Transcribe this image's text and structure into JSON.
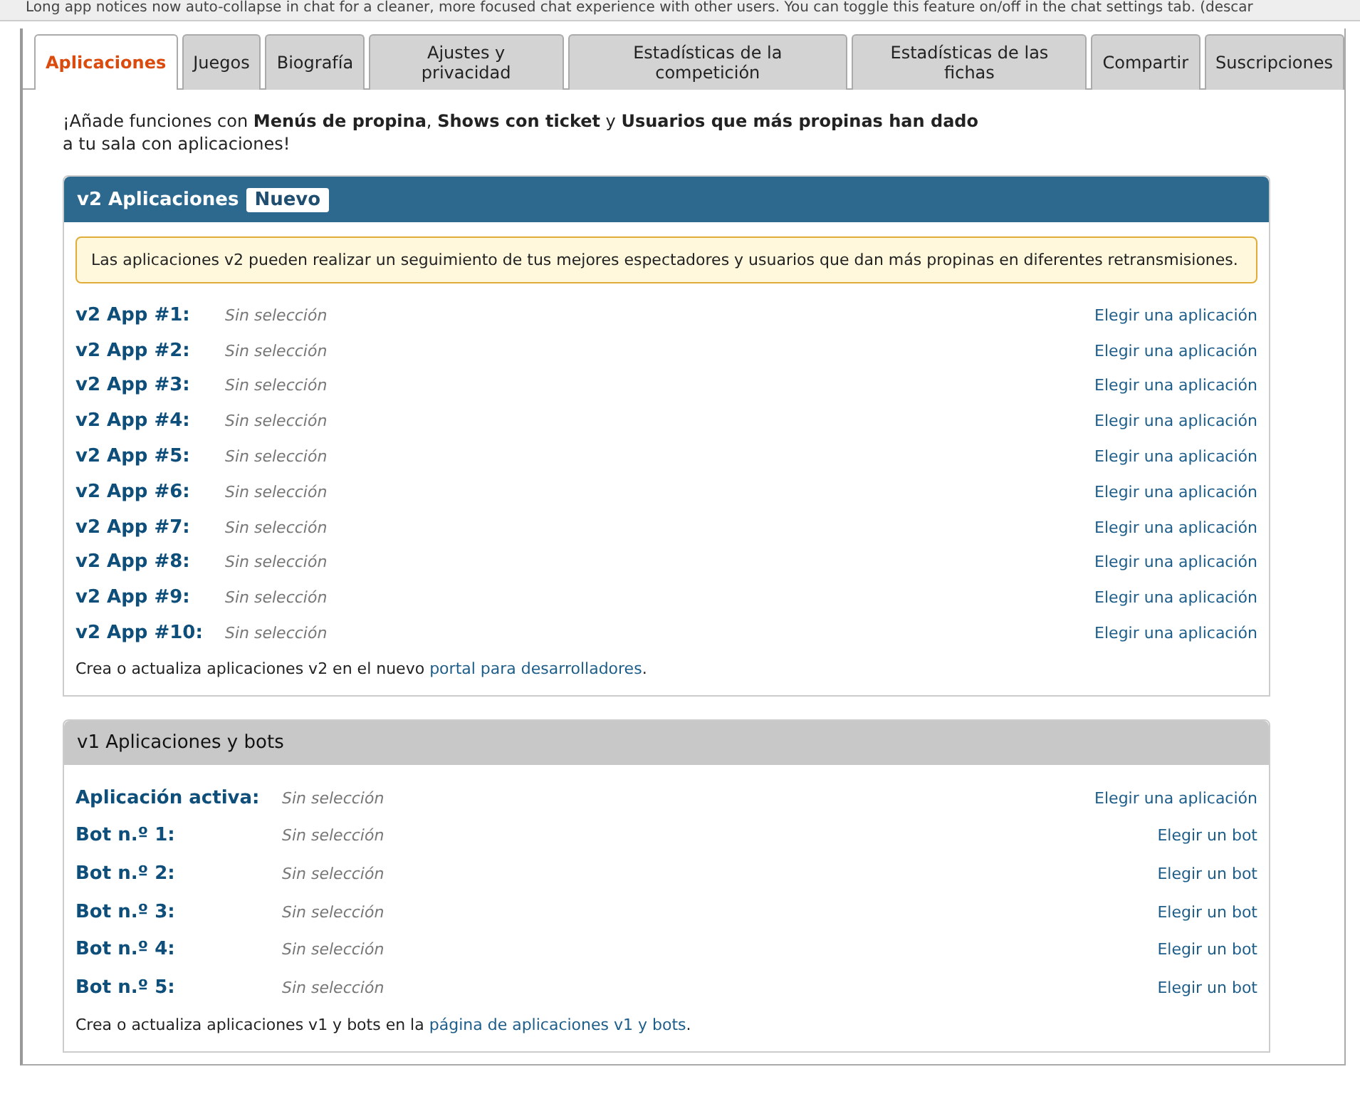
{
  "notice": "Long app notices now auto-collapse in chat for a cleaner, more focused chat experience with other users. You can toggle this feature on/off in the chat settings tab. (descar",
  "tabs": [
    {
      "label": "Aplicaciones",
      "selected": true
    },
    {
      "label": "Juegos",
      "selected": false
    },
    {
      "label": "Biografía",
      "selected": false
    },
    {
      "label": "Ajustes y privacidad",
      "selected": false
    },
    {
      "label": "Estadísticas de la competición",
      "selected": false
    },
    {
      "label": "Estadísticas de las fichas",
      "selected": false
    },
    {
      "label": "Compartir",
      "selected": false
    },
    {
      "label": "Suscripciones",
      "selected": false
    }
  ],
  "intro": [
    "¡Añade funciones con **Menús de propina**, **Shows con ticket** y **Usuarios que más propinas han dado**",
    "a tu sala con aplicaciones!"
  ],
  "panels": [
    {
      "kind": "featured",
      "title": "v2 Aplicaciones",
      "badge": "Nuevo",
      "info": "Las aplicaciones v2 pueden realizar un seguimiento de tus mejores espectadores y usuarios que dan más propinas en diferentes retransmisiones.",
      "rows": [
        {
          "label": "v2 App #1:",
          "value": "Sin selección",
          "action": "Elegir una aplicación"
        },
        {
          "label": "v2 App #2:",
          "value": "Sin selección",
          "action": "Elegir una aplicación"
        },
        {
          "label": "v2 App #3:",
          "value": "Sin selección",
          "action": "Elegir una aplicación"
        },
        {
          "label": "v2 App #4:",
          "value": "Sin selección",
          "action": "Elegir una aplicación"
        },
        {
          "label": "v2 App #5:",
          "value": "Sin selección",
          "action": "Elegir una aplicación"
        },
        {
          "label": "v2 App #6:",
          "value": "Sin selección",
          "action": "Elegir una aplicación"
        },
        {
          "label": "v2 App #7:",
          "value": "Sin selección",
          "action": "Elegir una aplicación"
        },
        {
          "label": "v2 App #8:",
          "value": "Sin selección",
          "action": "Elegir una aplicación"
        },
        {
          "label": "v2 App #9:",
          "value": "Sin selección",
          "action": "Elegir una aplicación"
        },
        {
          "label": "v2 App #10:",
          "value": "Sin selección",
          "action": "Elegir una aplicación"
        }
      ],
      "footer": {
        "before": "Crea o actualiza aplicaciones v2 en el nuevo",
        "link": "portal para desarrolladores",
        "after": "."
      }
    },
    {
      "kind": "legacy",
      "title": "v1 Aplicaciones y bots",
      "rows": [
        {
          "label": "Aplicación activa:",
          "value": "Sin selección",
          "action": "Elegir una aplicación"
        },
        {
          "label": "Bot n.º 1:",
          "value": "Sin selección",
          "action": "Elegir un bot"
        },
        {
          "label": "Bot n.º 2:",
          "value": "Sin selección",
          "action": "Elegir un bot"
        },
        {
          "label": "Bot n.º 3:",
          "value": "Sin selección",
          "action": "Elegir un bot"
        },
        {
          "label": "Bot n.º 4:",
          "value": "Sin selección",
          "action": "Elegir un bot"
        },
        {
          "label": "Bot n.º 5:",
          "value": "Sin selección",
          "action": "Elegir un bot"
        }
      ],
      "footer": {
        "before": "Crea o actualiza aplicaciones v1 y bots en la",
        "link": "página de aplicaciones v1 y bots",
        "after": "."
      }
    }
  ]
}
